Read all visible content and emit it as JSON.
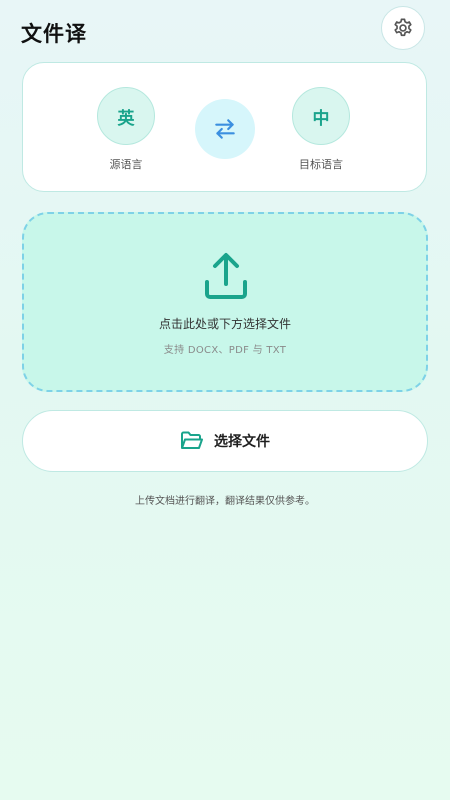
{
  "header": {
    "title": "文件译",
    "settings_icon": "gear-icon"
  },
  "languages": {
    "source": {
      "code": "英",
      "label": "源语言"
    },
    "target": {
      "code": "中",
      "label": "目标语言"
    },
    "swap_icon": "swap-arrows-icon"
  },
  "dropzone": {
    "icon": "upload-icon",
    "title": "点击此处或下方选择文件",
    "hint": "支持 DOCX、PDF 与 TXT"
  },
  "select_button": {
    "icon": "folder-open-icon",
    "label": "选择文件"
  },
  "footer": {
    "note": "上传文档进行翻译，翻译结果仅供参考。"
  },
  "colors": {
    "accent": "#1aa48c",
    "swap": "#3b8fe0",
    "dropzone_bg": "#c8f7ea",
    "dropzone_border": "#7ed2e7"
  }
}
